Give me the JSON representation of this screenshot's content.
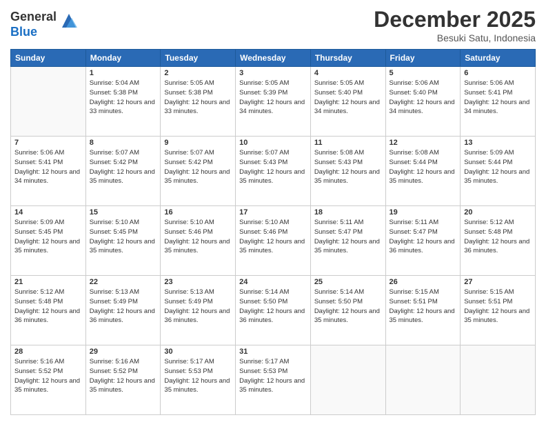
{
  "header": {
    "logo_general": "General",
    "logo_blue": "Blue",
    "title": "December 2025",
    "location": "Besuki Satu, Indonesia"
  },
  "weekdays": [
    "Sunday",
    "Monday",
    "Tuesday",
    "Wednesday",
    "Thursday",
    "Friday",
    "Saturday"
  ],
  "weeks": [
    [
      {
        "day": "",
        "sunrise": "",
        "sunset": "",
        "daylight": "",
        "empty": true
      },
      {
        "day": "1",
        "sunrise": "5:04 AM",
        "sunset": "5:38 PM",
        "daylight": "12 hours and 33 minutes."
      },
      {
        "day": "2",
        "sunrise": "5:05 AM",
        "sunset": "5:38 PM",
        "daylight": "12 hours and 33 minutes."
      },
      {
        "day": "3",
        "sunrise": "5:05 AM",
        "sunset": "5:39 PM",
        "daylight": "12 hours and 34 minutes."
      },
      {
        "day": "4",
        "sunrise": "5:05 AM",
        "sunset": "5:40 PM",
        "daylight": "12 hours and 34 minutes."
      },
      {
        "day": "5",
        "sunrise": "5:06 AM",
        "sunset": "5:40 PM",
        "daylight": "12 hours and 34 minutes."
      },
      {
        "day": "6",
        "sunrise": "5:06 AM",
        "sunset": "5:41 PM",
        "daylight": "12 hours and 34 minutes."
      }
    ],
    [
      {
        "day": "7",
        "sunrise": "5:06 AM",
        "sunset": "5:41 PM",
        "daylight": "12 hours and 34 minutes."
      },
      {
        "day": "8",
        "sunrise": "5:07 AM",
        "sunset": "5:42 PM",
        "daylight": "12 hours and 35 minutes."
      },
      {
        "day": "9",
        "sunrise": "5:07 AM",
        "sunset": "5:42 PM",
        "daylight": "12 hours and 35 minutes."
      },
      {
        "day": "10",
        "sunrise": "5:07 AM",
        "sunset": "5:43 PM",
        "daylight": "12 hours and 35 minutes."
      },
      {
        "day": "11",
        "sunrise": "5:08 AM",
        "sunset": "5:43 PM",
        "daylight": "12 hours and 35 minutes."
      },
      {
        "day": "12",
        "sunrise": "5:08 AM",
        "sunset": "5:44 PM",
        "daylight": "12 hours and 35 minutes."
      },
      {
        "day": "13",
        "sunrise": "5:09 AM",
        "sunset": "5:44 PM",
        "daylight": "12 hours and 35 minutes."
      }
    ],
    [
      {
        "day": "14",
        "sunrise": "5:09 AM",
        "sunset": "5:45 PM",
        "daylight": "12 hours and 35 minutes."
      },
      {
        "day": "15",
        "sunrise": "5:10 AM",
        "sunset": "5:45 PM",
        "daylight": "12 hours and 35 minutes."
      },
      {
        "day": "16",
        "sunrise": "5:10 AM",
        "sunset": "5:46 PM",
        "daylight": "12 hours and 35 minutes."
      },
      {
        "day": "17",
        "sunrise": "5:10 AM",
        "sunset": "5:46 PM",
        "daylight": "12 hours and 35 minutes."
      },
      {
        "day": "18",
        "sunrise": "5:11 AM",
        "sunset": "5:47 PM",
        "daylight": "12 hours and 35 minutes."
      },
      {
        "day": "19",
        "sunrise": "5:11 AM",
        "sunset": "5:47 PM",
        "daylight": "12 hours and 36 minutes."
      },
      {
        "day": "20",
        "sunrise": "5:12 AM",
        "sunset": "5:48 PM",
        "daylight": "12 hours and 36 minutes."
      }
    ],
    [
      {
        "day": "21",
        "sunrise": "5:12 AM",
        "sunset": "5:48 PM",
        "daylight": "12 hours and 36 minutes."
      },
      {
        "day": "22",
        "sunrise": "5:13 AM",
        "sunset": "5:49 PM",
        "daylight": "12 hours and 36 minutes."
      },
      {
        "day": "23",
        "sunrise": "5:13 AM",
        "sunset": "5:49 PM",
        "daylight": "12 hours and 36 minutes."
      },
      {
        "day": "24",
        "sunrise": "5:14 AM",
        "sunset": "5:50 PM",
        "daylight": "12 hours and 36 minutes."
      },
      {
        "day": "25",
        "sunrise": "5:14 AM",
        "sunset": "5:50 PM",
        "daylight": "12 hours and 35 minutes."
      },
      {
        "day": "26",
        "sunrise": "5:15 AM",
        "sunset": "5:51 PM",
        "daylight": "12 hours and 35 minutes."
      },
      {
        "day": "27",
        "sunrise": "5:15 AM",
        "sunset": "5:51 PM",
        "daylight": "12 hours and 35 minutes."
      }
    ],
    [
      {
        "day": "28",
        "sunrise": "5:16 AM",
        "sunset": "5:52 PM",
        "daylight": "12 hours and 35 minutes."
      },
      {
        "day": "29",
        "sunrise": "5:16 AM",
        "sunset": "5:52 PM",
        "daylight": "12 hours and 35 minutes."
      },
      {
        "day": "30",
        "sunrise": "5:17 AM",
        "sunset": "5:53 PM",
        "daylight": "12 hours and 35 minutes."
      },
      {
        "day": "31",
        "sunrise": "5:17 AM",
        "sunset": "5:53 PM",
        "daylight": "12 hours and 35 minutes."
      },
      {
        "day": "",
        "sunrise": "",
        "sunset": "",
        "daylight": "",
        "empty": true
      },
      {
        "day": "",
        "sunrise": "",
        "sunset": "",
        "daylight": "",
        "empty": true
      },
      {
        "day": "",
        "sunrise": "",
        "sunset": "",
        "daylight": "",
        "empty": true
      }
    ]
  ],
  "labels": {
    "sunrise_prefix": "Sunrise: ",
    "sunset_prefix": "Sunset: ",
    "daylight_prefix": "Daylight: "
  }
}
